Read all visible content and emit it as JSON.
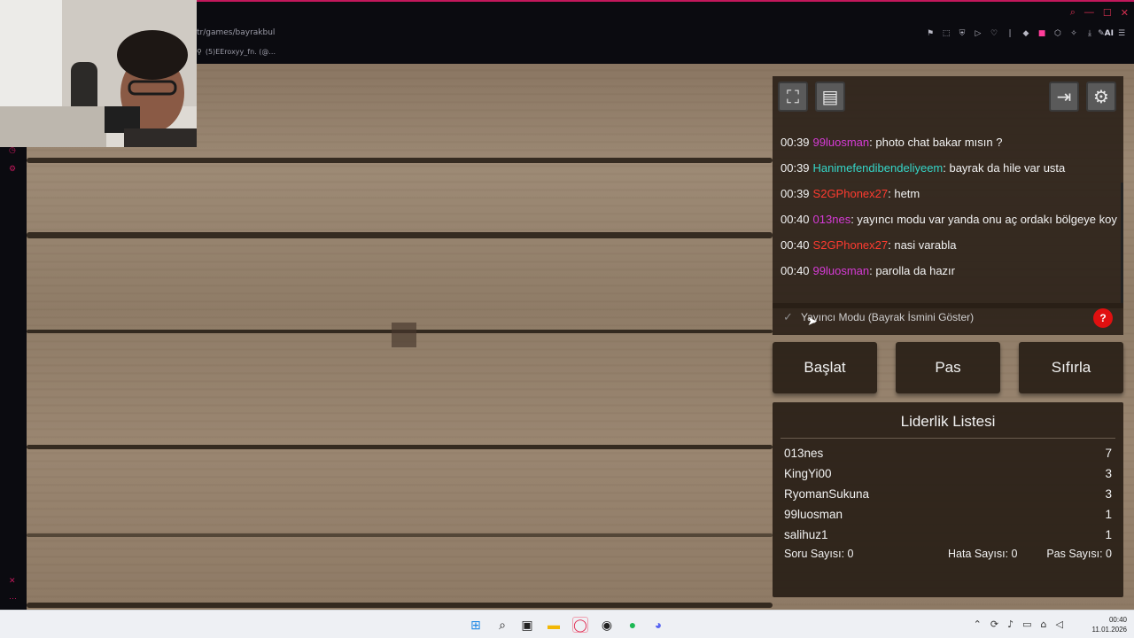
{
  "browser": {
    "url": "tr/games/bayrakbul",
    "tab_title": "(5)EEroxyy_fn. (@...",
    "ai_label": "AI"
  },
  "chat": {
    "messages": [
      {
        "time": "00:39",
        "user": "99luosman",
        "color": "#d63bd6",
        "text": ": photo chat bakar mısın ?"
      },
      {
        "time": "00:39",
        "user": "Hanimefendibendeliyeem",
        "color": "#35d6c8",
        "text": ": bayrak da hile var usta"
      },
      {
        "time": "00:39",
        "user": "S2GPhonex27",
        "color": "#ff3b30",
        "text": ": hetm"
      },
      {
        "time": "00:40",
        "user": "013nes",
        "color": "#d63bd6",
        "text": ": yayıncı modu var yanda onu aç ordakı bölgeye koy"
      },
      {
        "time": "00:40",
        "user": "S2GPhonex27",
        "color": "#ff3b30",
        "text": ": nasi varabla"
      },
      {
        "time": "00:40",
        "user": "99luosman",
        "color": "#d63bd6",
        "text": ": parolla da hazır"
      }
    ]
  },
  "streamer_mode": {
    "label": "Yayıncı Modu (Bayrak İsmini Göster)",
    "check": "✓",
    "help": "?"
  },
  "buttons": {
    "start": "Başlat",
    "pass": "Pas",
    "reset": "Sıfırla"
  },
  "leaderboard": {
    "title": "Liderlik Listesi",
    "rows": [
      {
        "name": "013nes",
        "score": "7"
      },
      {
        "name": "KingYi00",
        "score": "3"
      },
      {
        "name": "RyomanSukuna",
        "score": "3"
      },
      {
        "name": "99luosman",
        "score": "1"
      },
      {
        "name": "salihuz1",
        "score": "1"
      }
    ],
    "stats": {
      "questions": "Soru Sayısı: 0",
      "errors": "Hata Sayısı: 0",
      "passes": "Pas Sayısı: 0"
    }
  },
  "taskbar": {
    "time": "00:40",
    "date": "11.01.2026"
  }
}
